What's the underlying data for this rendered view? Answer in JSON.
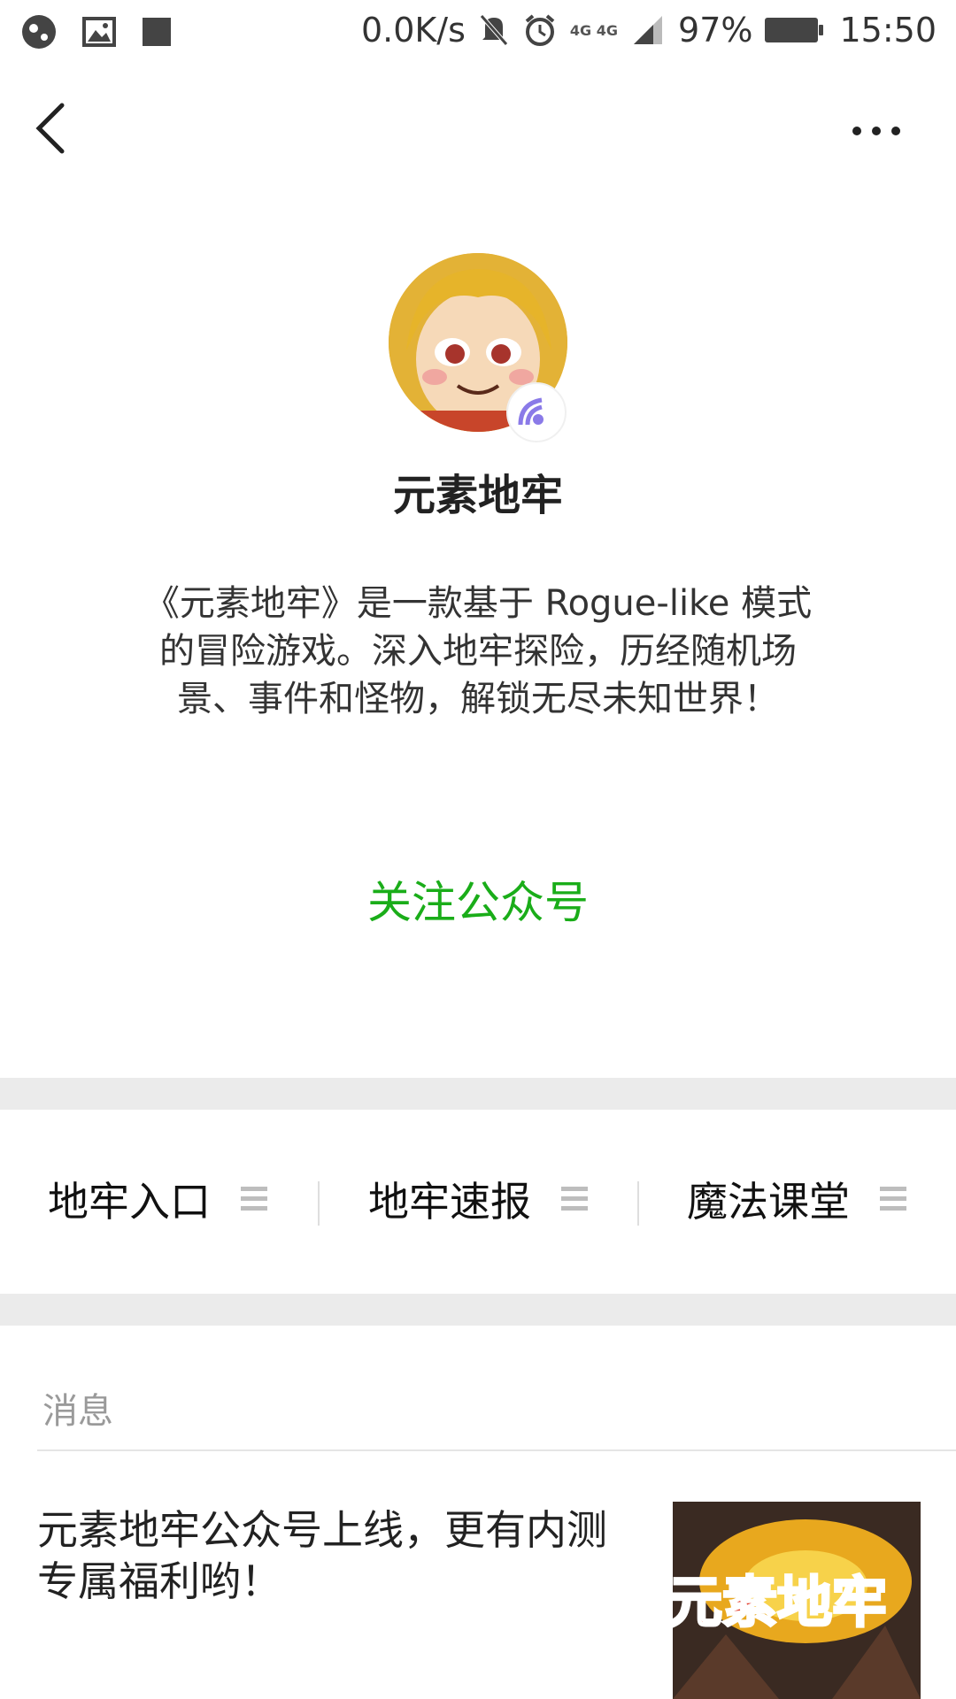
{
  "status_bar": {
    "speed": "0.0K/s",
    "network": "4G 4G",
    "battery": "97%",
    "time": "15:50"
  },
  "profile": {
    "name": "元素地牢",
    "description": "《元素地牢》是一款基于 Rogue-like 模式的冒险游戏。深入地牢探险，历经随机场景、事件和怪物，解锁无尽未知世界！",
    "follow_label": "关注公众号"
  },
  "menu": {
    "items": [
      {
        "label": "地牢入口"
      },
      {
        "label": "地牢速报"
      },
      {
        "label": "魔法课堂"
      }
    ]
  },
  "messages": {
    "header": "消息",
    "items": [
      {
        "title": "元素地牢公众号上线，更有内测专属福利哟！",
        "thumb_text": "元素地牢"
      }
    ]
  },
  "colors": {
    "accent": "#1aad19",
    "separator": "#ebebeb"
  }
}
